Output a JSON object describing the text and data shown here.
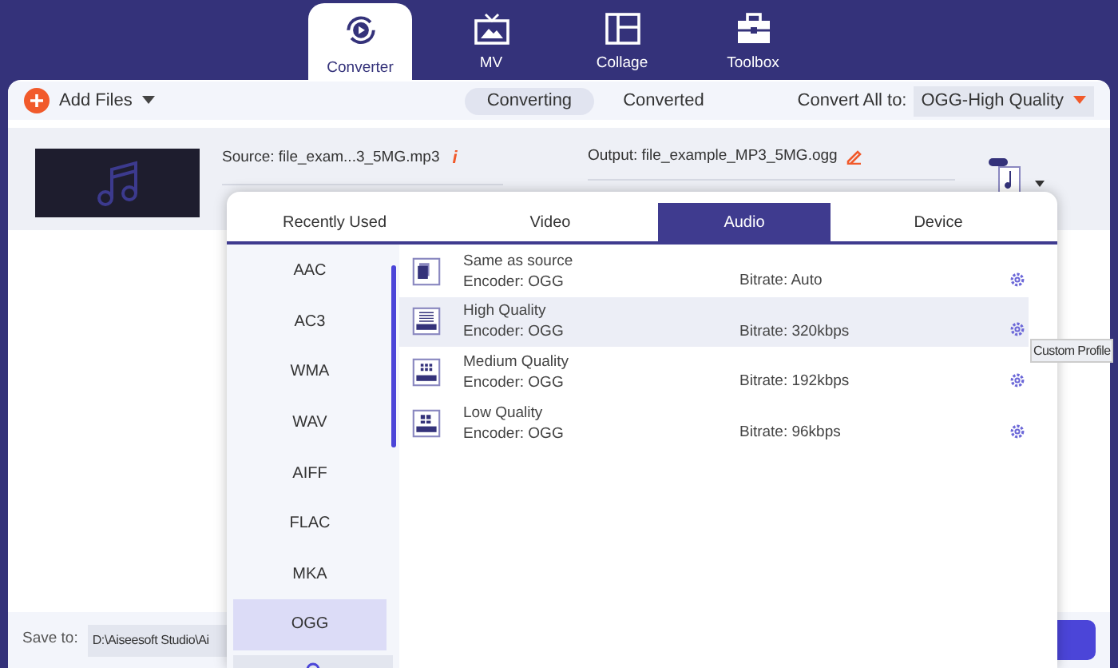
{
  "nav_tabs": [
    {
      "label": "Converter",
      "selected": true
    },
    {
      "label": "MV",
      "selected": false
    },
    {
      "label": "Collage",
      "selected": false
    },
    {
      "label": "Toolbox",
      "selected": false
    }
  ],
  "toolbar": {
    "add_files": "Add Files",
    "view_tabs": [
      {
        "label": "Converting",
        "selected": true
      },
      {
        "label": "Converted",
        "selected": false
      }
    ],
    "convert_all_label": "Convert All to:",
    "convert_all_value": "OGG-High Quality"
  },
  "file": {
    "source": "Source: file_exam...3_5MG.mp3",
    "output": "Output: file_example_MP3_5MG.ogg",
    "info_icon": "i"
  },
  "save_to": {
    "label": "Save to:",
    "path": "D:\\Aiseesoft Studio\\Ai"
  },
  "format_popup": {
    "tabs": [
      {
        "label": "Recently Used",
        "selected": false
      },
      {
        "label": "Video",
        "selected": false
      },
      {
        "label": "Audio",
        "selected": true
      },
      {
        "label": "Device",
        "selected": false
      }
    ],
    "formats": [
      {
        "label": "AAC",
        "selected": false
      },
      {
        "label": "AC3",
        "selected": false
      },
      {
        "label": "WMA",
        "selected": false
      },
      {
        "label": "WAV",
        "selected": false
      },
      {
        "label": "AIFF",
        "selected": false
      },
      {
        "label": "FLAC",
        "selected": false
      },
      {
        "label": "MKA",
        "selected": false
      },
      {
        "label": "OGG",
        "selected": true
      }
    ],
    "profiles": [
      {
        "kind": "source",
        "name": "Same as source",
        "encoder": "Encoder: OGG",
        "bitrate": "Bitrate: Auto",
        "selected": false
      },
      {
        "kind": "high",
        "name": "High Quality",
        "encoder": "Encoder: OGG",
        "bitrate": "Bitrate: 320kbps",
        "selected": true
      },
      {
        "kind": "medium",
        "name": "Medium Quality",
        "encoder": "Encoder: OGG",
        "bitrate": "Bitrate: 192kbps",
        "selected": false
      },
      {
        "kind": "low",
        "name": "Low Quality",
        "encoder": "Encoder: OGG",
        "bitrate": "Bitrate: 96kbps",
        "selected": false
      }
    ],
    "tooltip": "Custom Profile"
  }
}
